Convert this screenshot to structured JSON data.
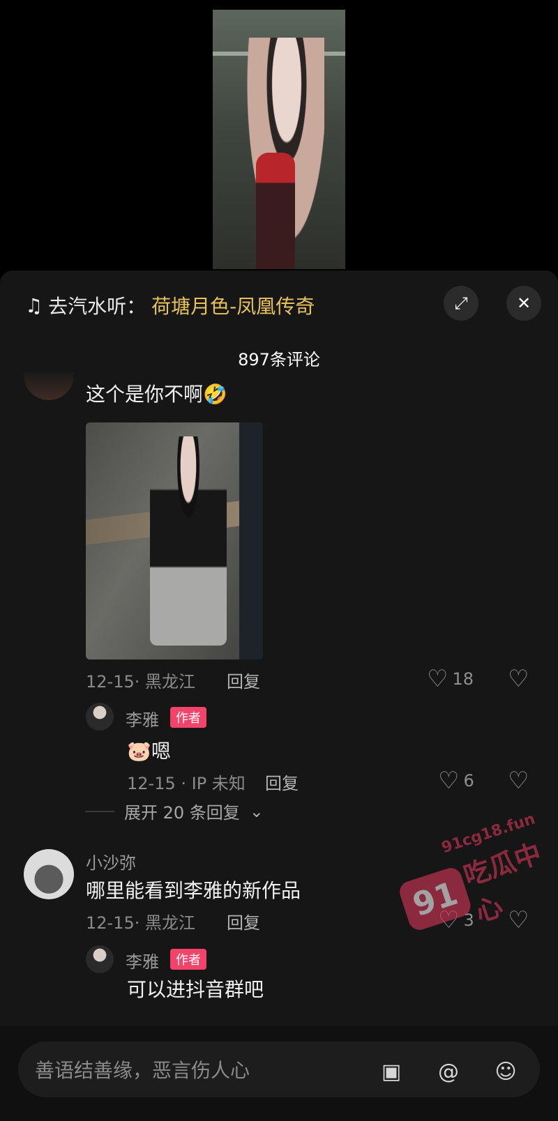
{
  "header": {
    "music_prefix": "去汽水听：",
    "music_title": "荷塘月色-凤凰传奇",
    "comment_count": "897条评论"
  },
  "comments": [
    {
      "text": "这个是你不啊🤣",
      "meta": "12-15· 黑龙江",
      "reply": "回复",
      "likes": "18"
    },
    {
      "name": "李雅",
      "badge": "作者",
      "text": "🐷嗯",
      "meta": "12-15 · IP 未知",
      "reply": "回复",
      "likes": "6"
    },
    {
      "expand": "展开 20 条回复"
    },
    {
      "name": "小沙弥",
      "text": "哪里能看到李雅的新作品",
      "meta": "12-15· 黑龙江",
      "reply": "回复",
      "likes": "3"
    },
    {
      "name": "李雅",
      "badge": "作者",
      "text": "可以进抖音群吧"
    }
  ],
  "watermark": {
    "site": "91cg18.fun",
    "number": "91",
    "title": "吃瓜中心"
  },
  "input": {
    "placeholder": "善语结善缘，恶言伤人心"
  }
}
